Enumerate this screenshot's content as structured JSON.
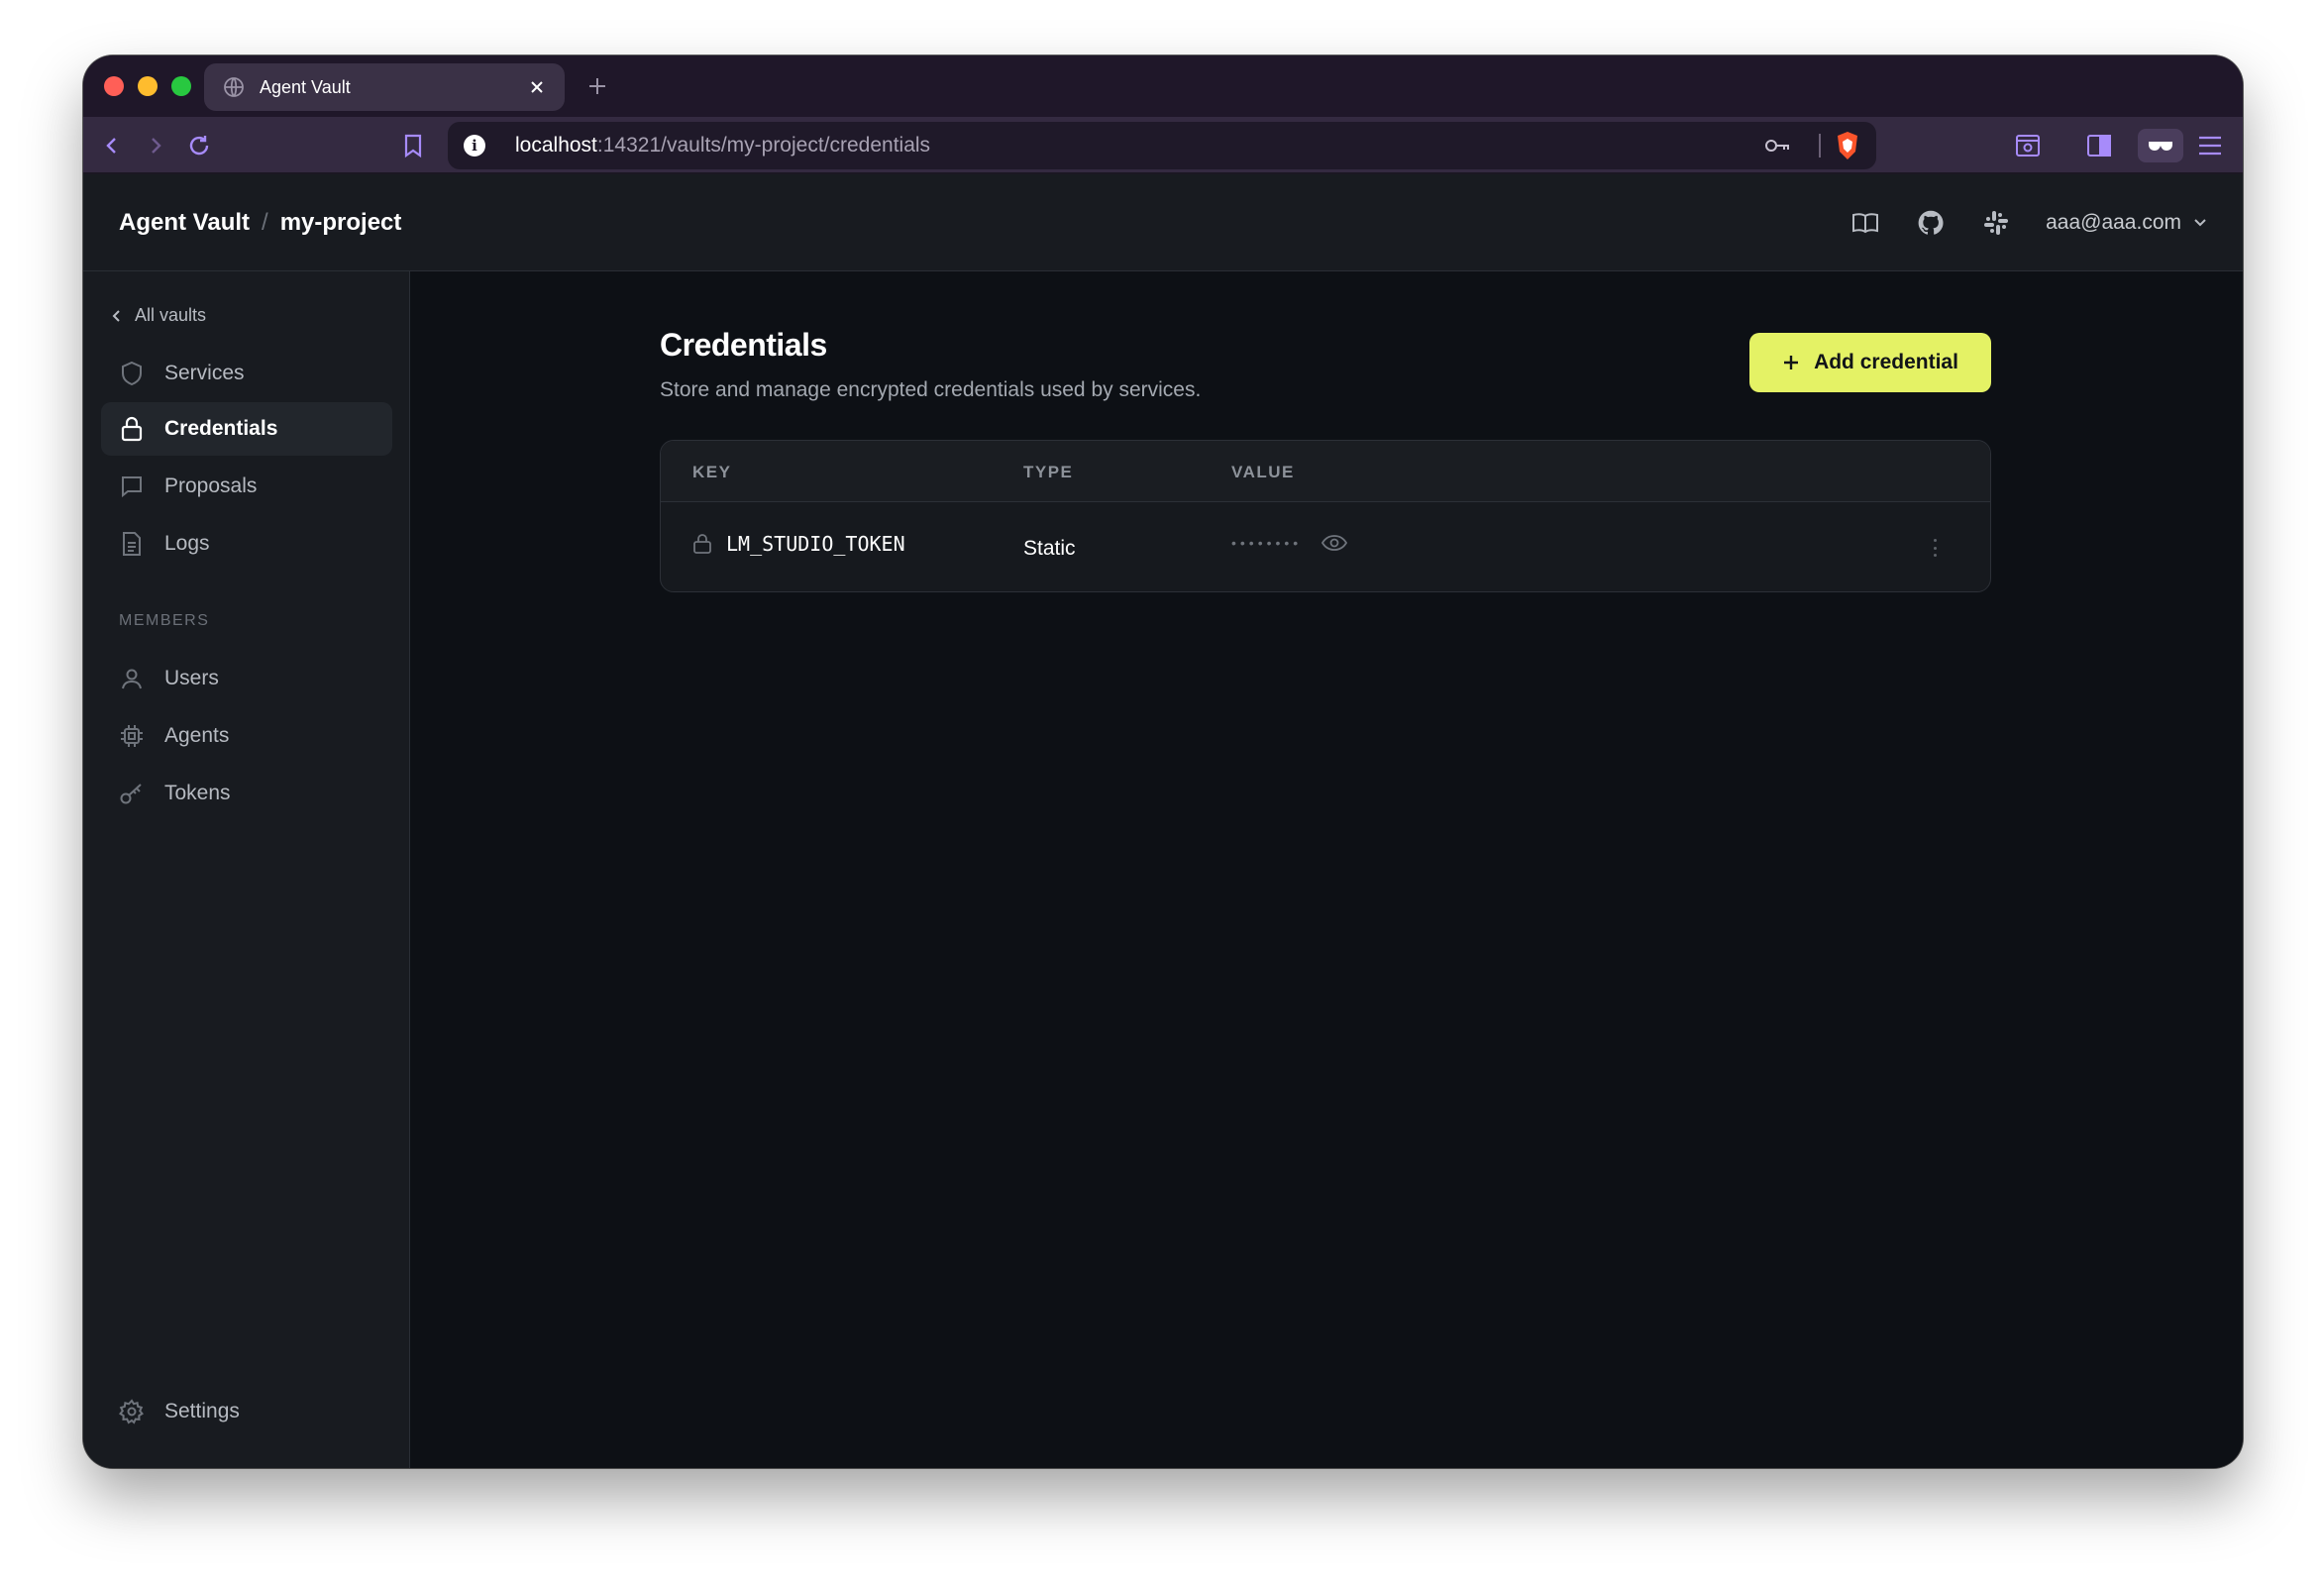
{
  "browser": {
    "tab_title": "Agent Vault",
    "url_host": "localhost",
    "url_path": ":14321/vaults/my-project/credentials"
  },
  "header": {
    "app_name": "Agent Vault",
    "separator": "/",
    "project": "my-project",
    "user_email": "aaa@aaa.com",
    "icons": [
      "book-icon",
      "github-icon",
      "slack-icon"
    ]
  },
  "sidebar": {
    "back_label": "All vaults",
    "items": [
      {
        "label": "Services",
        "icon": "shield-icon"
      },
      {
        "label": "Credentials",
        "icon": "lock-icon",
        "active": true
      },
      {
        "label": "Proposals",
        "icon": "chat-icon"
      },
      {
        "label": "Logs",
        "icon": "document-icon"
      }
    ],
    "members_label": "MEMBERS",
    "member_items": [
      {
        "label": "Users",
        "icon": "user-icon"
      },
      {
        "label": "Agents",
        "icon": "chip-icon"
      },
      {
        "label": "Tokens",
        "icon": "key-icon"
      }
    ],
    "settings_label": "Settings"
  },
  "main": {
    "title": "Credentials",
    "subtitle": "Store and manage encrypted credentials used by services.",
    "add_button": "Add credential",
    "table": {
      "columns": [
        "KEY",
        "TYPE",
        "VALUE"
      ],
      "rows": [
        {
          "key": "LM_STUDIO_TOKEN",
          "type": "Static",
          "value": "••••••••"
        }
      ]
    }
  },
  "colors": {
    "accent": "#e4f265",
    "background": "#0d1015",
    "sidebar": "#181b20",
    "browser_chrome": "#342a41"
  }
}
